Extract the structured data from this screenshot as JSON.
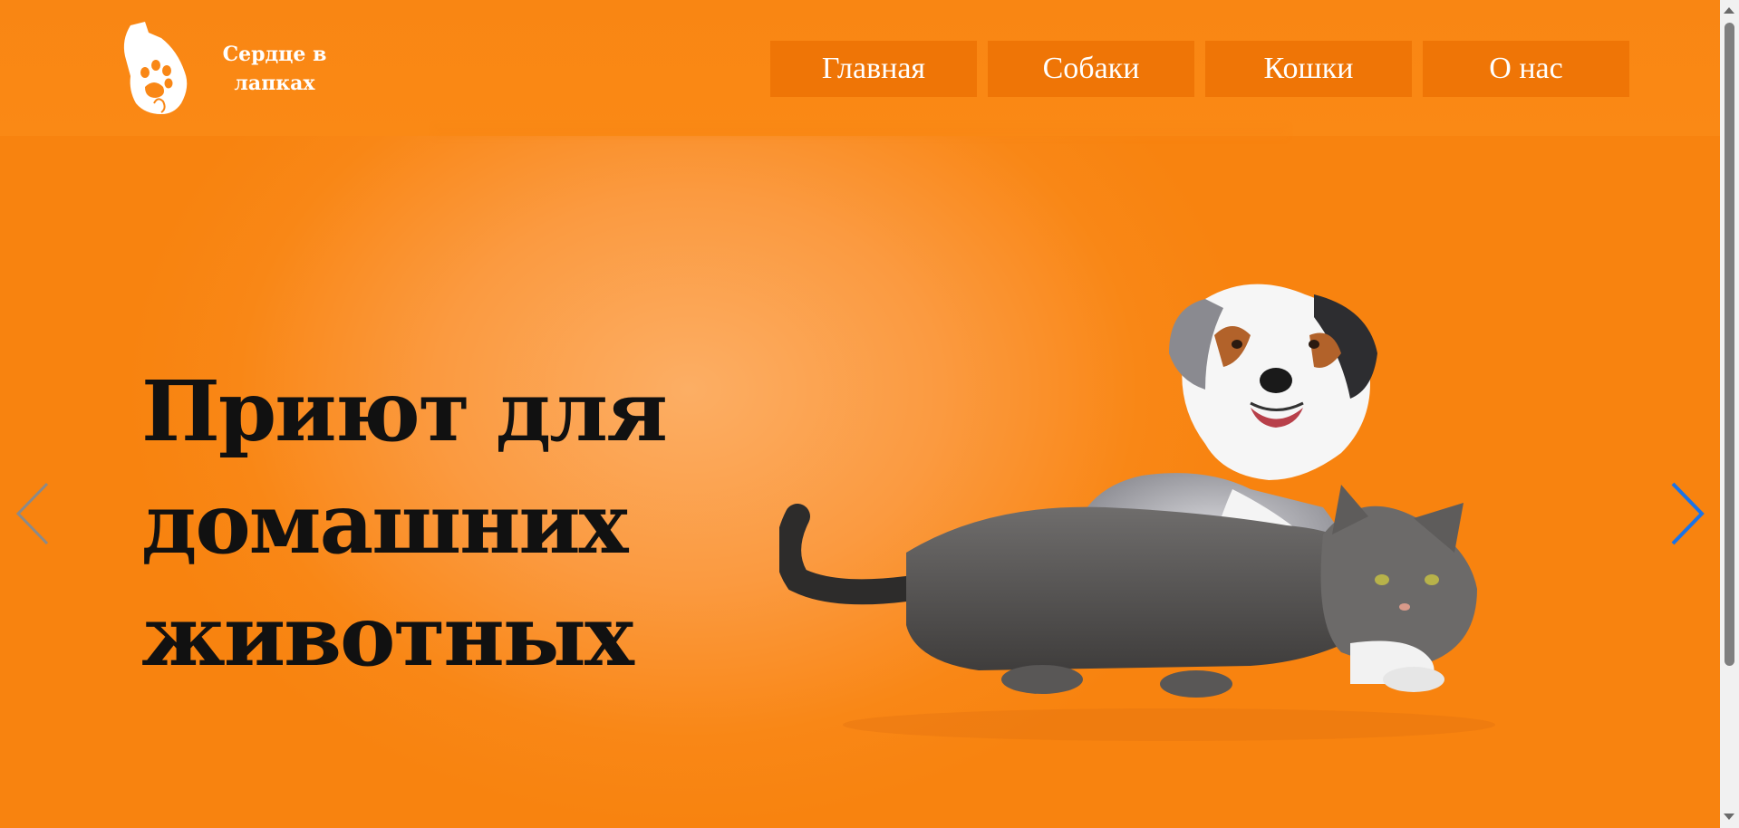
{
  "brand": {
    "name_line1": "Сердце в",
    "name_line2": "лапках",
    "logo_icon": "hand-paw-logo-icon"
  },
  "nav": {
    "items": [
      {
        "label": "Главная"
      },
      {
        "label": "Собаки"
      },
      {
        "label": "Кошки"
      },
      {
        "label": "О нас"
      }
    ]
  },
  "hero": {
    "title_line1": "Приют для",
    "title_line2": "домашних",
    "title_line3": "животных",
    "image": "dog-and-cat-illustration",
    "prev_icon": "chevron-left-icon",
    "next_icon": "chevron-right-icon"
  },
  "colors": {
    "background": "#f98716",
    "nav_button": "#ef7506",
    "title_text": "#111111",
    "next_arrow": "#1a73e8",
    "prev_arrow": "#8a8a8a"
  }
}
